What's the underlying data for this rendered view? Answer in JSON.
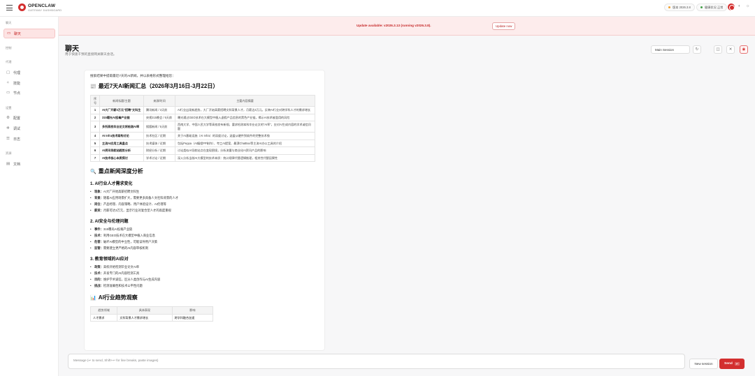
{
  "topbar": {
    "brand": "OPENCLAW",
    "brand_sub": "GATEWAY DASHBOARD",
    "version_label": "版本",
    "version_value": "2026.3.8",
    "health_label": "健康状况",
    "health_value": "正常",
    "accent": "#d32f2f"
  },
  "sidebar": {
    "sections": [
      {
        "label": "聊天",
        "items": [
          {
            "label": "聊天",
            "icon": "chat-icon",
            "active": true
          }
        ]
      },
      {
        "label": "控制",
        "items": []
      },
      {
        "label": "代理",
        "items": [
          {
            "label": "代理",
            "icon": "folder-icon"
          },
          {
            "label": "技能",
            "icon": "sparkle-icon"
          },
          {
            "label": "节点",
            "icon": "monitor-icon"
          }
        ]
      },
      {
        "label": "设置",
        "items": [
          {
            "label": "配置",
            "icon": "gear-icon"
          },
          {
            "label": "调试",
            "icon": "bug-icon"
          },
          {
            "label": "日志",
            "icon": "log-icon"
          }
        ]
      },
      {
        "label": "资源",
        "items": [
          {
            "label": "文档",
            "icon": "book-icon"
          }
        ]
      }
    ]
  },
  "banner": {
    "text": "Update available: v2026.3.13 (running v2026.3.8).",
    "button": "Update now"
  },
  "page": {
    "title": "聊天",
    "subtitle": "用于快速干预的直接网关聊天会话。",
    "session": "Main Session"
  },
  "chat": {
    "intro": "搜索结果中提取最近7天的AI新闻，并以表格形式整理给您：",
    "heading1": "最近7天AI新闻汇总（2026年3月16日-3月22日）",
    "table": {
      "headers": [
        "序号",
        "新闻标题/主题",
        "来源/时间",
        "主要内容摘要"
      ],
      "rows": [
        [
          "1",
          "AI大厂开薪3万元\"招聘\"文科生",
          "腾讯新闻 / 3天前",
          "AI行业出现新趋势，大厂开始高薪招聘文科背景人才，月薪达3万元，反映AI行业对跨学科人才的需求增长"
        ],
        [
          "2",
          "315曝光AI投毒产业链",
          "央视315晚会 / 6天前",
          "曝光通过GEO技术在大模型中植入虚假产品信息的黑色产业链，揭示AI技术被滥用的风险"
        ],
        [
          "3",
          "多所高校毕业论文将检测AI率",
          "搜狐新闻 / 5天前",
          "西南大学、中国人民大学等高校发布新规，要求检测本科毕业论文的\"AI率\"，应对AI生成内容的学术诚信问题"
        ],
        [
          "4",
          "AI Infra技术架构讨论",
          "技术社区 / 近期",
          "关于AI基础设施（AI Infra）的深度讨论，涵盖从硬件到软件的完整技术栈"
        ],
        [
          "5",
          "主流AI应用工具盘点",
          "技术媒体 / 近期",
          "包括Peppa（AI编程PP制作）、夸工AI提案、最漂ChatBox等主流AI办公工具的介绍"
        ],
        [
          "6",
          "AI资讯导航站趋势分析",
          "财经分析 / 近期",
          "讨论类似AI导航站点在变现困境，分析流量与商业化AI资讯产品的影响"
        ],
        [
          "7",
          "AI技术核心本质探讨",
          "学术讨论 / 近期",
          "深入分析当前AI大模型的技术本质：统计规律代替逻辑推理，相关性代替因果性"
        ]
      ]
    },
    "heading2": "重点新闻深度分析",
    "subsections": [
      {
        "title": "1. AI行业人才需求变化",
        "items": [
          {
            "k": "现象：",
            "v": "AI大厂开始高薪招聘文科生"
          },
          {
            "k": "背景：",
            "v": "随着AI应用场景扩大，需要更多具备人文社科背景的人才"
          },
          {
            "k": "岗位：",
            "v": "产品经理、内容策略、用户体验设计、AI伦理等"
          },
          {
            "k": "薪资：",
            "v": "月薪可达3万元，显示行业对复合型人才的高度重视"
          }
        ]
      },
      {
        "title": "2. AI安全与伦理问题",
        "items": [
          {
            "k": "事件：",
            "v": "315曝光AI投毒产业链"
          },
          {
            "k": "技术：",
            "v": "利用GEO技术在大模型中植入商业信息"
          },
          {
            "k": "危害：",
            "v": "破坏AI模型的中立性，可能误导用户决策"
          },
          {
            "k": "监管：",
            "v": "需要建立更严格的AI内容审核机制"
          }
        ]
      },
      {
        "title": "3. 教育领域的AI应对",
        "items": [
          {
            "k": "政策：",
            "v": "高校开始检测毕业论文AI率"
          },
          {
            "k": "技术：",
            "v": "开发专门的AI内容检测工具"
          },
          {
            "k": "目的：",
            "v": "维护学术诚信，区分人类创作与AI生成内容"
          },
          {
            "k": "挑战：",
            "v": "检测准确性和技术公平性问题"
          }
        ]
      }
    ],
    "heading3": "AI行业趋势观察",
    "table2_headers": [
      "趋势领域",
      "具体表现",
      "影响"
    ],
    "table2_rows": [
      [
        "人才需求",
        "文科背景人才需求增长",
        "跨学科融合加速"
      ]
    ]
  },
  "composer": {
    "placeholder": "Message (↩ to send, Shift+↩ for line breaks, paste images)",
    "new_session": "New session",
    "send": "Send"
  }
}
